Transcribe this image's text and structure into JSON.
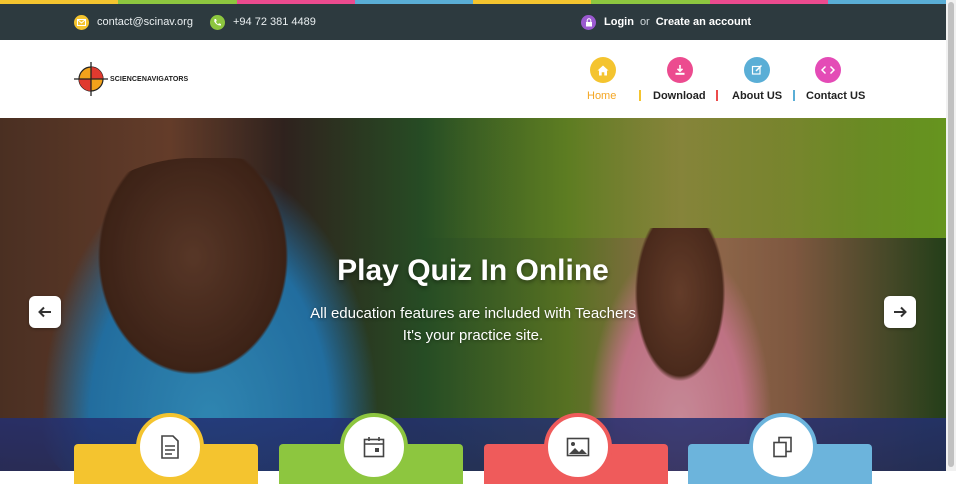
{
  "topbar": {
    "email": "contact@scinav.org",
    "phone": "+94 72 381 4489",
    "login_label": "Login",
    "or_label": "or",
    "create_account_label": "Create an account",
    "icons": [
      "mail-icon",
      "phone-icon",
      "lock-icon"
    ],
    "bg_color": "#2d3a3f"
  },
  "logo": {
    "text": "SCIENCENAVIGATORS"
  },
  "nav": {
    "items": [
      {
        "label": "Home",
        "icon": "home-icon",
        "color": "#f4c42f",
        "active": true
      },
      {
        "label": "Download",
        "icon": "download-icon",
        "color": "#ec4b8f"
      },
      {
        "label": "About US",
        "icon": "edit-icon",
        "color": "#5aaed6"
      },
      {
        "label": "Contact US",
        "icon": "code-icon",
        "color": "#e44bb6"
      }
    ],
    "active_color": "#f4a623"
  },
  "hero": {
    "title": "Play Quiz In Online",
    "subtitle_line1": "All education features are included with Teachers",
    "subtitle_line2": "It's your practice site."
  },
  "slider": {
    "prev_icon": "arrow-left-icon",
    "next_icon": "arrow-right-icon"
  },
  "features": [
    {
      "icon": "document-icon",
      "color": "#f4c42f"
    },
    {
      "icon": "calendar-icon",
      "color": "#8dc63f"
    },
    {
      "icon": "image-icon",
      "color": "#ef5b5b"
    },
    {
      "icon": "copy-icon",
      "color": "#6cb4dc"
    }
  ],
  "stripe_colors": [
    "#f4c42f",
    "#8dc63f",
    "#ec4b8f",
    "#5aaed6",
    "#f4c42f",
    "#8dc63f",
    "#ec4b8f",
    "#5aaed6"
  ]
}
